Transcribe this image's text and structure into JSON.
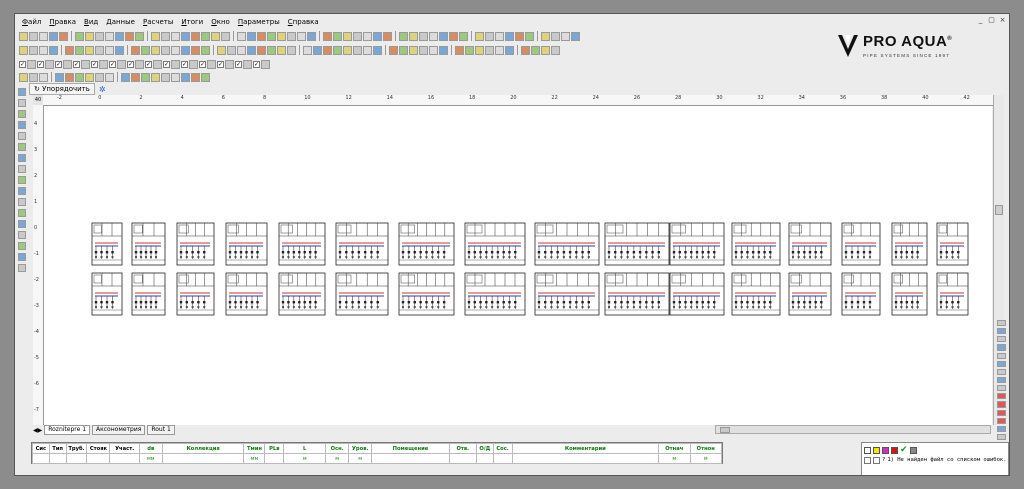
{
  "menu": [
    "Файл",
    "Правка",
    "Вид",
    "Данные",
    "Расчеты",
    "Итоги",
    "Окно",
    "Параметры",
    "Справка"
  ],
  "window_controls": [
    "_",
    "▢",
    "×"
  ],
  "logo": {
    "name": "PRO AQUA",
    "reg": "®",
    "tagline": "PIPE SYSTEMS SINCE 1997"
  },
  "tab": {
    "label": "Упорядочить"
  },
  "ruler_corner": "40",
  "ruler_h": [
    "-2",
    "0",
    "2",
    "4",
    "6",
    "8",
    "10",
    "12",
    "14",
    "16",
    "18",
    "20",
    "22",
    "24",
    "26",
    "28",
    "30",
    "32",
    "34",
    "36",
    "38",
    "40",
    "42"
  ],
  "ruler_v": [
    "4",
    "3",
    "2",
    "1",
    "0",
    "-1",
    "-2",
    "-3",
    "-4",
    "-5",
    "-6",
    "-7"
  ],
  "sheet_tabs": [
    "Roznitepre 1",
    "Аксонометрия",
    "Rout 1"
  ],
  "grid": {
    "headers": [
      "Сис",
      "Тип",
      "Труб.",
      "Стояк",
      "Участ.",
      "dв",
      "Коллекция",
      "Tмин",
      "PLв",
      "L",
      "Осн.",
      "Уров.",
      "Помещение",
      "Отв.",
      "О/Д",
      "Сос.",
      "Комментарии",
      "Отнач",
      "Отнон"
    ],
    "units": [
      "",
      "",
      "",
      "",
      "",
      "мм",
      "",
      "мм",
      "",
      "м",
      "м",
      "м",
      "",
      "",
      "",
      "",
      "",
      "м",
      "м"
    ]
  },
  "errors": {
    "swatch_colors": [
      "#ffffff",
      "#f2e600",
      "#d02bd0",
      "#e01010",
      "#888888"
    ],
    "ok_mark": "✔",
    "item_marker": "?",
    "message": "1) Не найден файл со списком ошибок."
  },
  "colors": {
    "supply": "#c0392b",
    "return": "#2c3ea8"
  }
}
